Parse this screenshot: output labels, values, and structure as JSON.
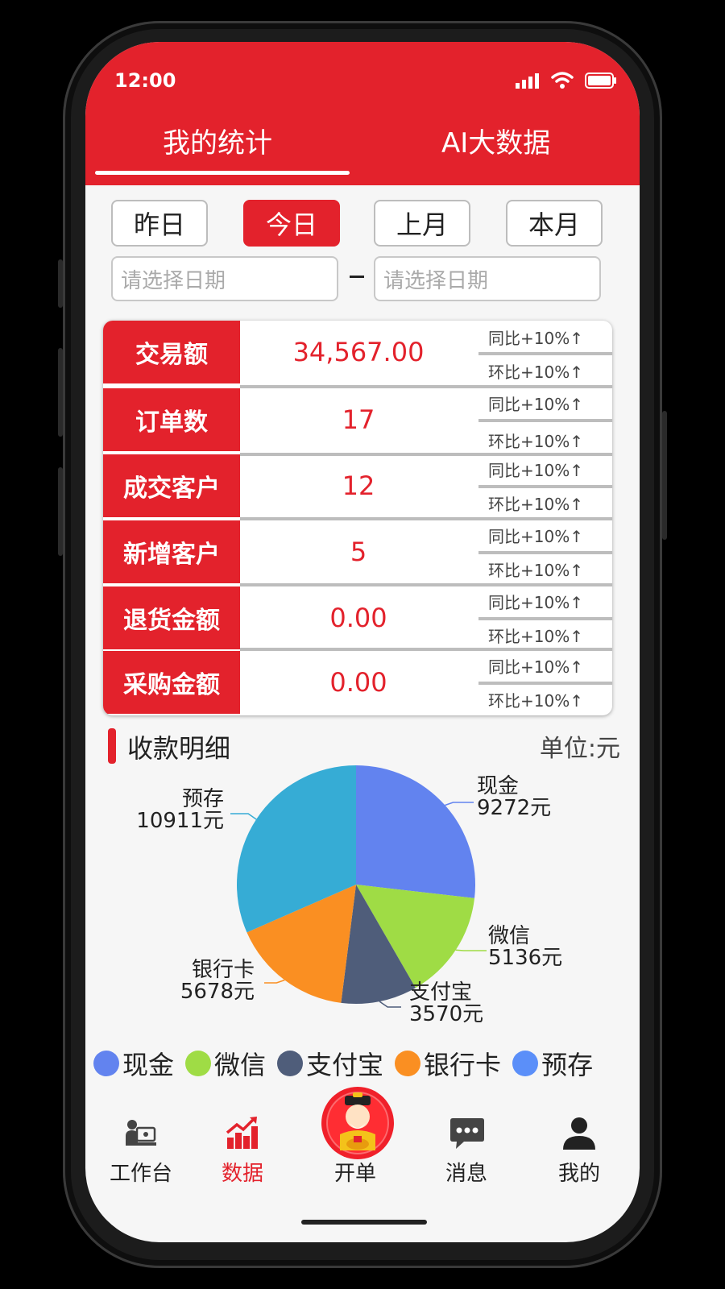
{
  "status": {
    "time": "12:00"
  },
  "tabs": [
    {
      "label": "我的统计",
      "active": true
    },
    {
      "label": "AI大数据",
      "active": false
    }
  ],
  "date_buttons": [
    {
      "label": "昨日",
      "active": false
    },
    {
      "label": "今日",
      "active": true
    },
    {
      "label": "上月",
      "active": false
    },
    {
      "label": "本月",
      "active": false
    }
  ],
  "date_range": {
    "start_placeholder": "请选择日期",
    "end_placeholder": "请选择日期"
  },
  "stats": [
    {
      "label": "交易额",
      "value": "34,567.00",
      "yoy": "同比+10%↑",
      "mom": "环比+10%↑"
    },
    {
      "label": "订单数",
      "value": "17",
      "yoy": "同比+10%↑",
      "mom": "环比+10%↑"
    },
    {
      "label": "成交客户",
      "value": "12",
      "yoy": "同比+10%↑",
      "mom": "环比+10%↑"
    },
    {
      "label": "新增客户",
      "value": "5",
      "yoy": "同比+10%↑",
      "mom": "环比+10%↑"
    },
    {
      "label": "退货金额",
      "value": "0.00",
      "yoy": "同比+10%↑",
      "mom": "环比+10%↑"
    },
    {
      "label": "采购金额",
      "value": "0.00",
      "yoy": "同比+10%↑",
      "mom": "环比+10%↑"
    }
  ],
  "receipts": {
    "title": "收款明细",
    "unit": "单位:元"
  },
  "chart_data": {
    "type": "pie",
    "title": "",
    "slices": [
      {
        "label": "现金",
        "value": 9272,
        "value_text": "9272元",
        "color": "#6283ef"
      },
      {
        "label": "微信",
        "value": 5136,
        "value_text": "5136元",
        "color": "#9fdc45"
      },
      {
        "label": "支付宝",
        "value": 3570,
        "value_text": "3570元",
        "color": "#4f5d7a"
      },
      {
        "label": "银行卡",
        "value": 5678,
        "value_text": "5678元",
        "color": "#fa8f22"
      },
      {
        "label": "预存",
        "value": 10911,
        "value_text": "10911元",
        "color": "#36acd5"
      }
    ],
    "legend": [
      {
        "label": "现金",
        "color": "#6283ef"
      },
      {
        "label": "微信",
        "color": "#9fdc45"
      },
      {
        "label": "支付宝",
        "color": "#4f5d7a"
      },
      {
        "label": "银行卡",
        "color": "#fa8f22"
      },
      {
        "label": "预存",
        "color": "#5b8ff9"
      }
    ]
  },
  "nav": [
    {
      "label": "工作台",
      "icon": "workbench-icon",
      "active": false
    },
    {
      "label": "数据",
      "icon": "chart-bars-icon",
      "active": true
    },
    {
      "label": "开单",
      "icon": "fortune-god-icon",
      "active": false
    },
    {
      "label": "消息",
      "icon": "message-bubble-icon",
      "active": false
    },
    {
      "label": "我的",
      "icon": "person-icon",
      "active": false
    }
  ],
  "colors": {
    "primary": "#e3222c",
    "background": "#f6f6f6"
  }
}
